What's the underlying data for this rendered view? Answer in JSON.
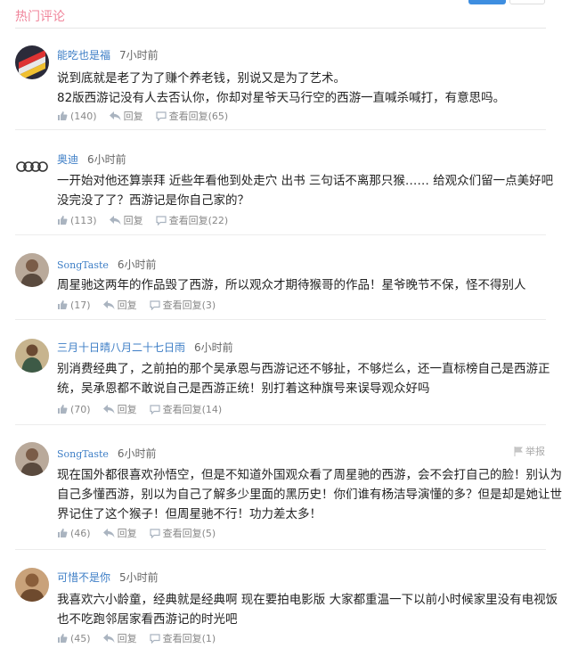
{
  "header": {
    "title": "热门评论"
  },
  "colors": {
    "title": "#f0859b",
    "username": "#3d7ec6",
    "primary_button": "#3e8ee0"
  },
  "icons": {
    "like": "thumb-up-icon",
    "reply": "reply-icon",
    "view_replies": "comment-icon",
    "report": "flag-icon"
  },
  "labels": {
    "reply": "回复",
    "view_replies": "查看回复",
    "report": "举报"
  },
  "comments": [
    {
      "username": "能吃也是福",
      "time": "7小时前",
      "lines": [
        "说到底就是老了为了赚个养老钱，别说又是为了艺术。",
        "82版西游记没有人去否认你，你却对星爷天马行空的西游一直喊杀喊打，有意思吗。"
      ],
      "likes": "(140)",
      "replies": "(65)",
      "avatar": "flag-avatar"
    },
    {
      "username": "奥迪",
      "time": "6小时前",
      "lines": [
        "一开始对他还算崇拜  近些年看他到处走穴  出书  三句话不离那只猴……  给观众们留一点美好吧",
        "没完没了了？西游记是你自己家的？"
      ],
      "likes": "(113)",
      "replies": "(22)",
      "avatar": "audi-rings-avatar"
    },
    {
      "username": "SongTaste",
      "time": "6小时前",
      "lines": [
        "周星驰这两年的作品毁了西游，所以观众才期待猴哥的作品！星爷晚节不保，怪不得别人"
      ],
      "likes": "(17)",
      "replies": "(3)",
      "avatar": "person-avatar"
    },
    {
      "username": "三月十日晴八月二十七日雨",
      "time": "6小时前",
      "lines": [
        "别消费经典了，之前拍的那个吴承恩与西游记还不够扯，不够烂么，还一直标榜自己是西游正",
        "统，吴承恩都不敢说自己是西游正统！别打着这种旗号来误导观众好吗"
      ],
      "likes": "(70)",
      "replies": "(14)",
      "avatar": "person-avatar"
    },
    {
      "username": "SongTaste",
      "time": "6小时前",
      "lines": [
        "现在国外都很喜欢孙悟空，但是不知道外国观众看了周星驰的西游，会不会打自己的脸！别认为",
        "自己多懂西游，别以为自己了解多少里面的黑历史！你们谁有杨洁导演懂的多？但是却是她让世",
        "界记住了这个猴子！但周星驰不行！功力差太多！"
      ],
      "likes": "(46)",
      "replies": "(5)",
      "avatar": "person-avatar",
      "show_report": true
    },
    {
      "username": "可惜不是你",
      "time": "5小时前",
      "lines": [
        "我喜欢六小龄童，经典就是经典啊  现在要拍电影版  大家都重温一下以前小时候家里没有电视饭",
        "也不吃跑邻居家看西游记的时光吧"
      ],
      "likes": "(45)",
      "replies": "(1)",
      "avatar": "person-avatar"
    }
  ]
}
